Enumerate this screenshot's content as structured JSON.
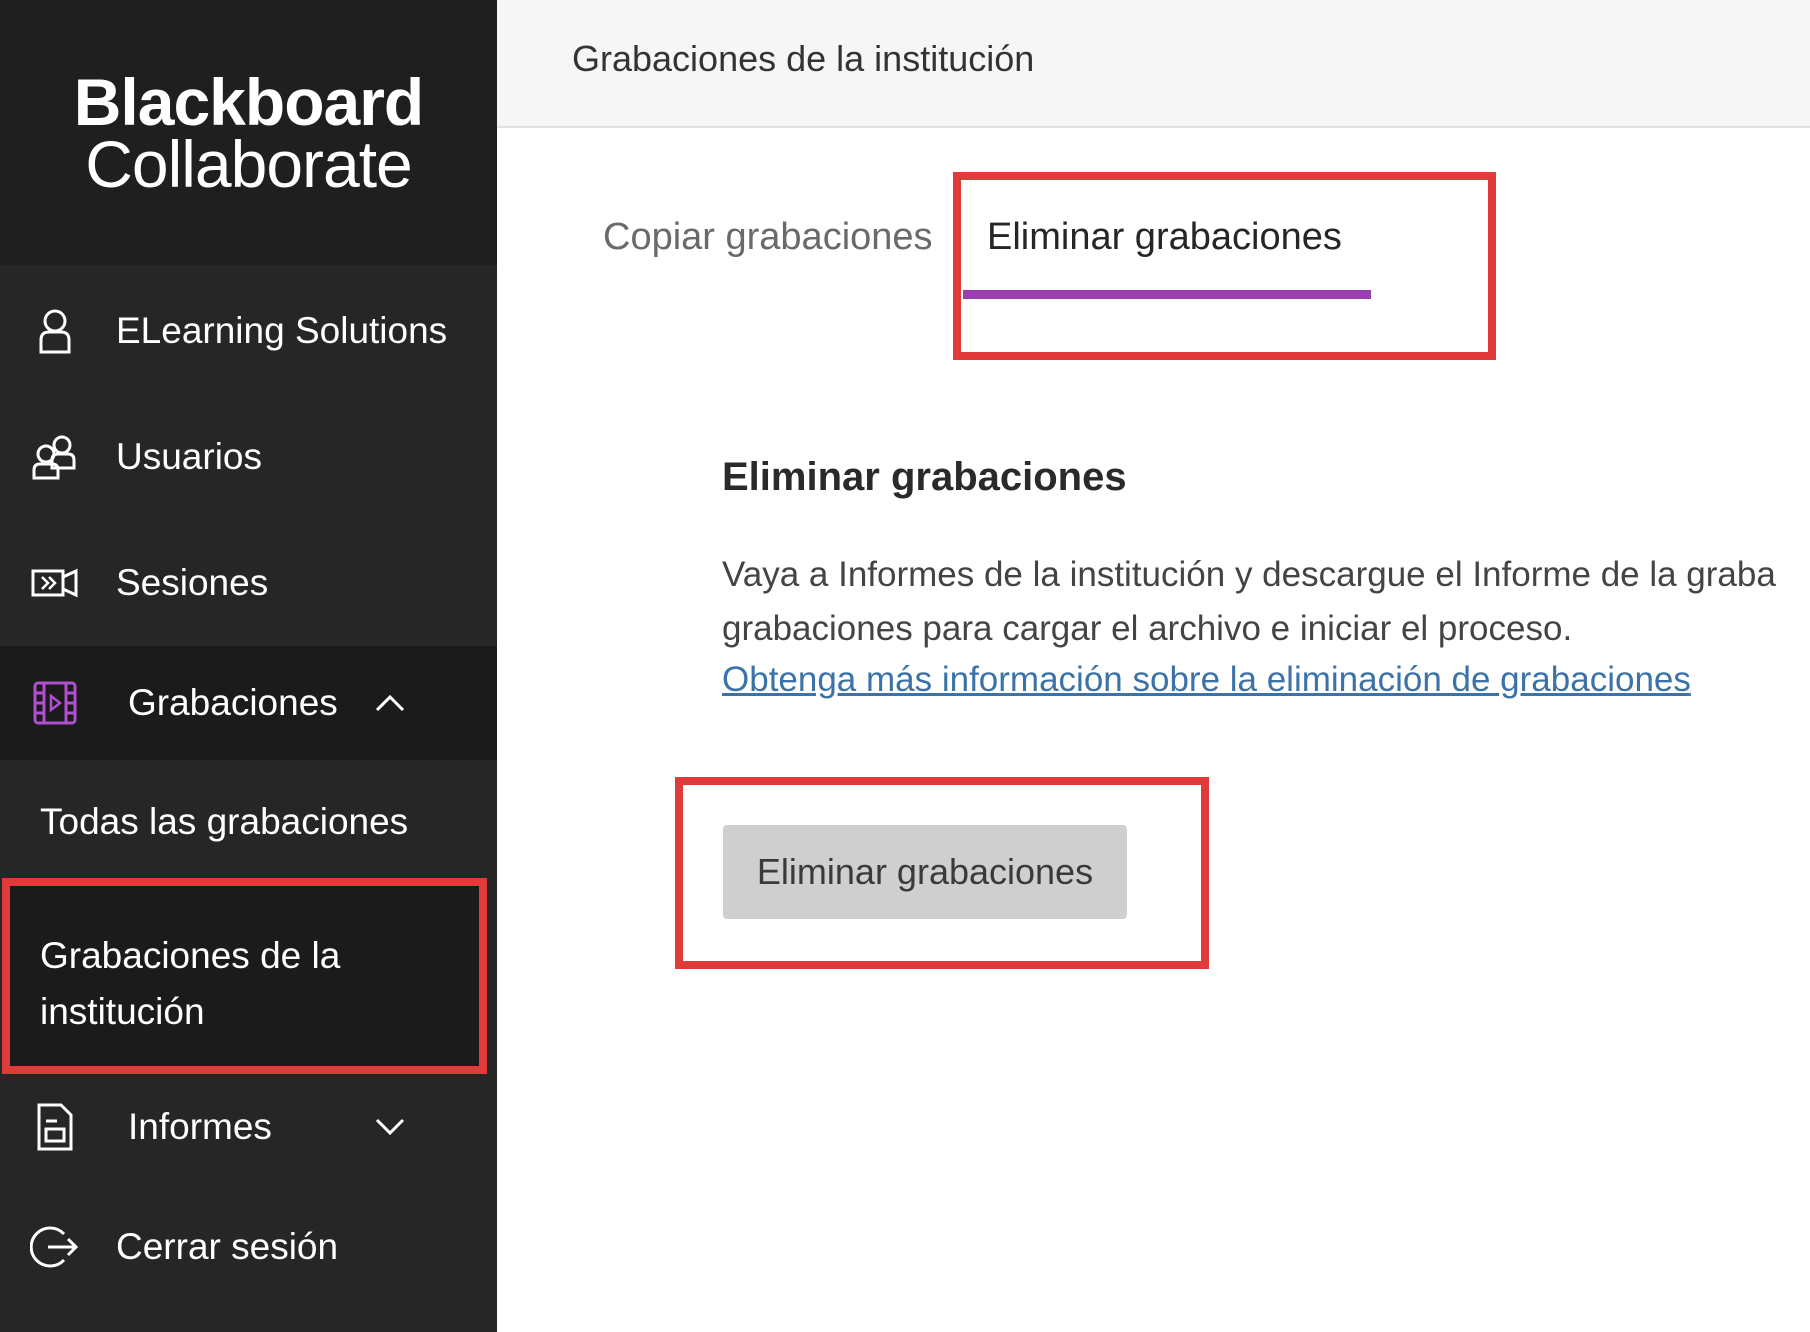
{
  "brand": {
    "line1": "Blackboard",
    "line2": "Collaborate"
  },
  "sidebar": {
    "items": [
      {
        "label": "ELearning Solutions",
        "icon": "user-icon"
      },
      {
        "label": "Usuarios",
        "icon": "users-icon"
      },
      {
        "label": "Sesiones",
        "icon": "sessions-icon"
      },
      {
        "label": "Grabaciones",
        "icon": "film-icon",
        "expanded": true
      },
      {
        "label": "Informes",
        "icon": "report-icon",
        "expanded": false
      },
      {
        "label": "Cerrar sesión",
        "icon": "logout-icon"
      }
    ],
    "subitems": [
      {
        "label": "Todas las grabaciones"
      },
      {
        "label": "Grabaciones de la institución",
        "current": true
      }
    ]
  },
  "header": {
    "title": "Grabaciones de la institución"
  },
  "tabs": [
    {
      "label": "Copiar grabaciones",
      "selected": false
    },
    {
      "label": "Eliminar grabaciones",
      "selected": true
    }
  ],
  "content": {
    "heading": "Eliminar grabaciones",
    "description_line1": "Vaya a Informes de la institución y descargue el Informe de la graba",
    "description_line2": "grabaciones para cargar el archivo e iniciar el proceso.",
    "link_text": "Obtenga más información sobre la eliminación de grabaciones",
    "button_label": "Eliminar grabaciones"
  },
  "colors": {
    "sidebar_bg": "#262626",
    "accent_purple": "#9b3fb0",
    "highlight_red": "#e03a3a",
    "link_blue": "#3b73a8",
    "button_bg": "#cfcfcf"
  }
}
